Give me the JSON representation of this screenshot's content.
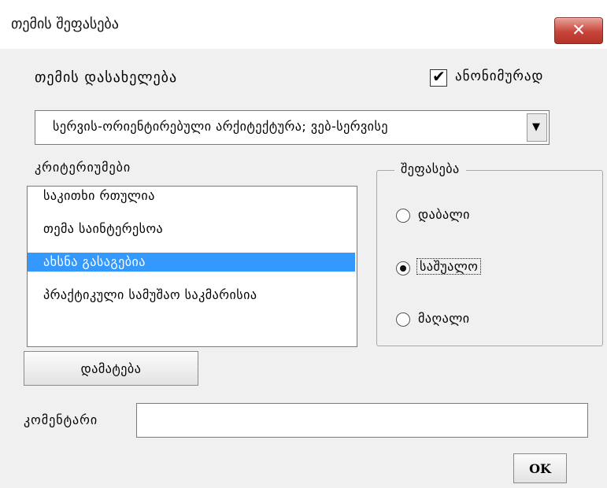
{
  "window": {
    "title": "თემის შეფასება"
  },
  "title_bar": {
    "close_icon": "close-x-icon",
    "close_glyph": "✕",
    "close_color": "#c8443a"
  },
  "topic_name": {
    "label": "თემის დასახელება"
  },
  "anonymous": {
    "label": "ანონიმურად",
    "checked": true,
    "check_glyph": "✔"
  },
  "topic_combo": {
    "value": "სერვის-ორიენტირებული არქიტექტურა; ვებ-სერვისე",
    "arrow_glyph": "▼"
  },
  "criteria": {
    "label": "კრიტერიუმები",
    "items": [
      {
        "label": "საკითხი რთულია",
        "selected": false
      },
      {
        "label": "თემა საინტერესოა",
        "selected": false
      },
      {
        "label": "ახსნა გასაგებია",
        "selected": true
      },
      {
        "label": "პრაქტიკული სამუშაო საკმარისია",
        "selected": false
      }
    ],
    "selection_color": "#3399ff"
  },
  "rating": {
    "legend": "შეფასება",
    "options": [
      {
        "label": "დაბალი",
        "checked": false
      },
      {
        "label": "საშუალო",
        "checked": true
      },
      {
        "label": "მაღალი",
        "checked": false
      }
    ]
  },
  "add_button": {
    "label": "დამატება"
  },
  "comment": {
    "label": "კომენტარი",
    "value": ""
  },
  "ok_button": {
    "label": "OK"
  }
}
